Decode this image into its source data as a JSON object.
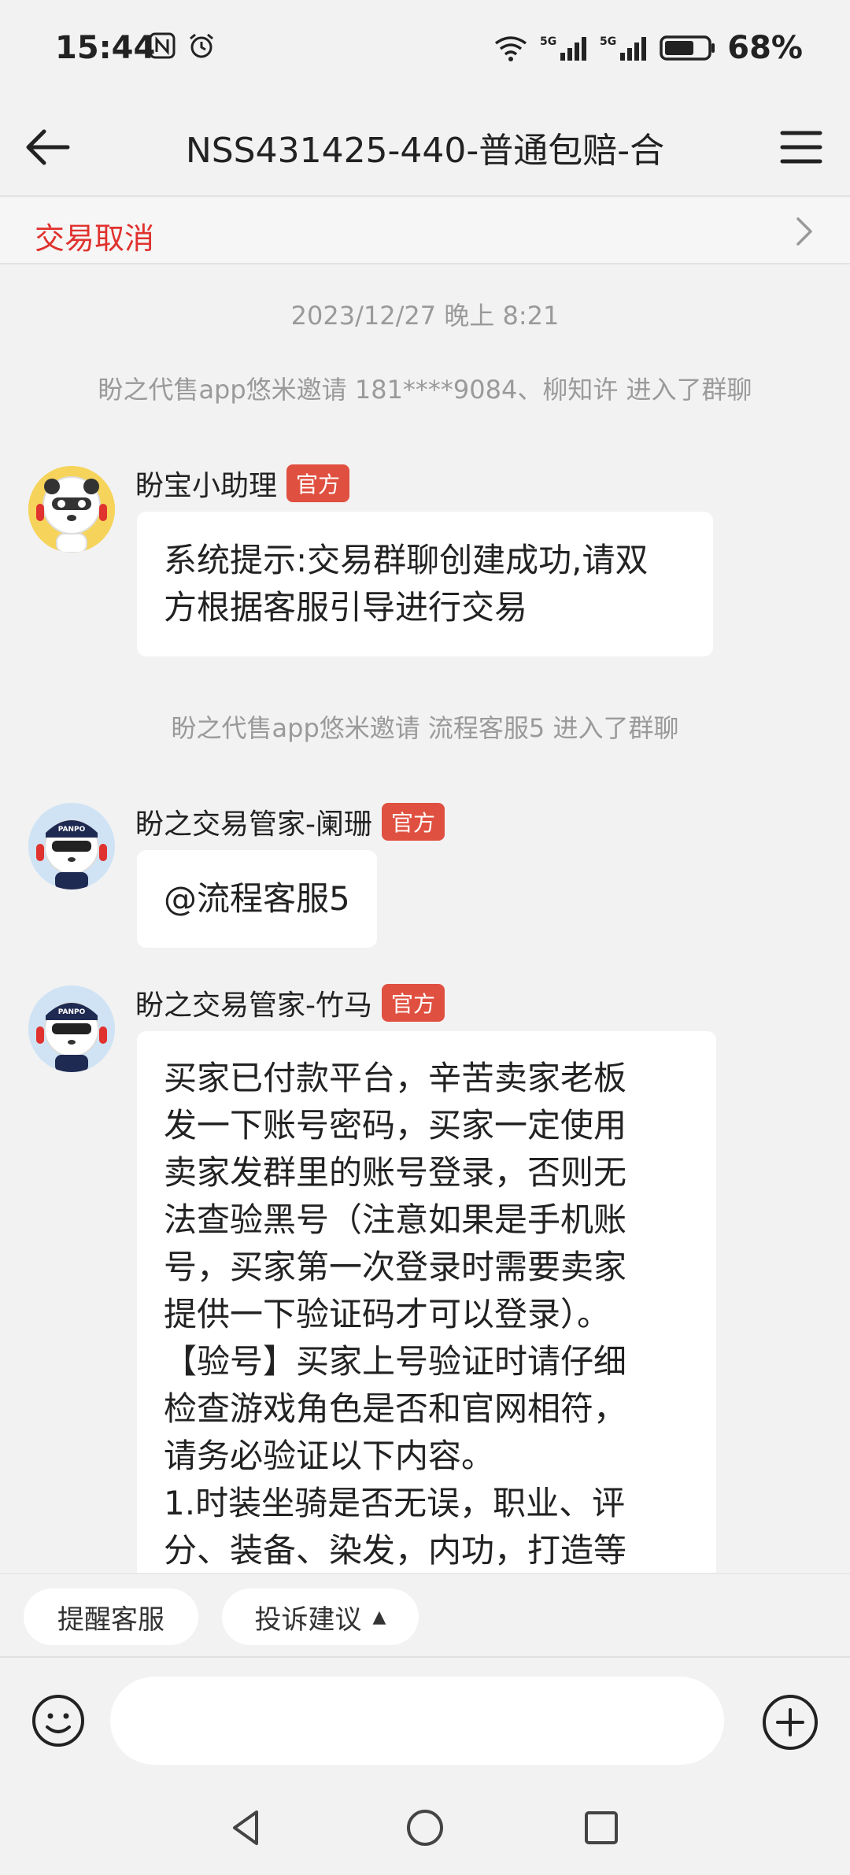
{
  "status_bar": {
    "time": "15:44",
    "battery": "68%"
  },
  "nav": {
    "title": "NSS431425-440-普通包赔-合"
  },
  "cancel_bar": {
    "label": "交易取消"
  },
  "chat": {
    "timestamp": "2023/12/27 晚上 8:21",
    "system1": "盼之代售app悠米邀请 181****9084、柳知许 进入了群聊",
    "system2": "盼之代售app悠米邀请 流程客服5 进入了群聊",
    "messages": [
      {
        "sender": "盼宝小助理",
        "badge": "官方",
        "lines": [
          "系统提示:交易群聊创建成功,请双",
          "方根据客服引导进行交易"
        ]
      },
      {
        "sender": "盼之交易管家-阑珊",
        "badge": "官方",
        "lines": [
          "@流程客服5"
        ]
      },
      {
        "sender": "盼之交易管家-竹马",
        "badge": "官方",
        "lines": [
          "买家已付款平台，辛苦卖家老板",
          "发一下账号密码，买家一定使用",
          "卖家发群里的账号登录，否则无",
          "法查验黑号（注意如果是手机账",
          "号，买家第一次登录时需要卖家",
          "提供一下验证码才可以登录）。",
          "【验号】买家上号验证时请仔细",
          "检查游戏角色是否和官网相符，",
          "请务必验证以下内容。",
          "1.时装坐骑是否无误，职业、评",
          "分、装备、染发，内功，打造等"
        ]
      }
    ]
  },
  "tools": {
    "remind": "提醒客服",
    "complaint": "投诉建议"
  },
  "colors": {
    "accent_red": "#e0322e",
    "badge_red": "#e05040"
  }
}
